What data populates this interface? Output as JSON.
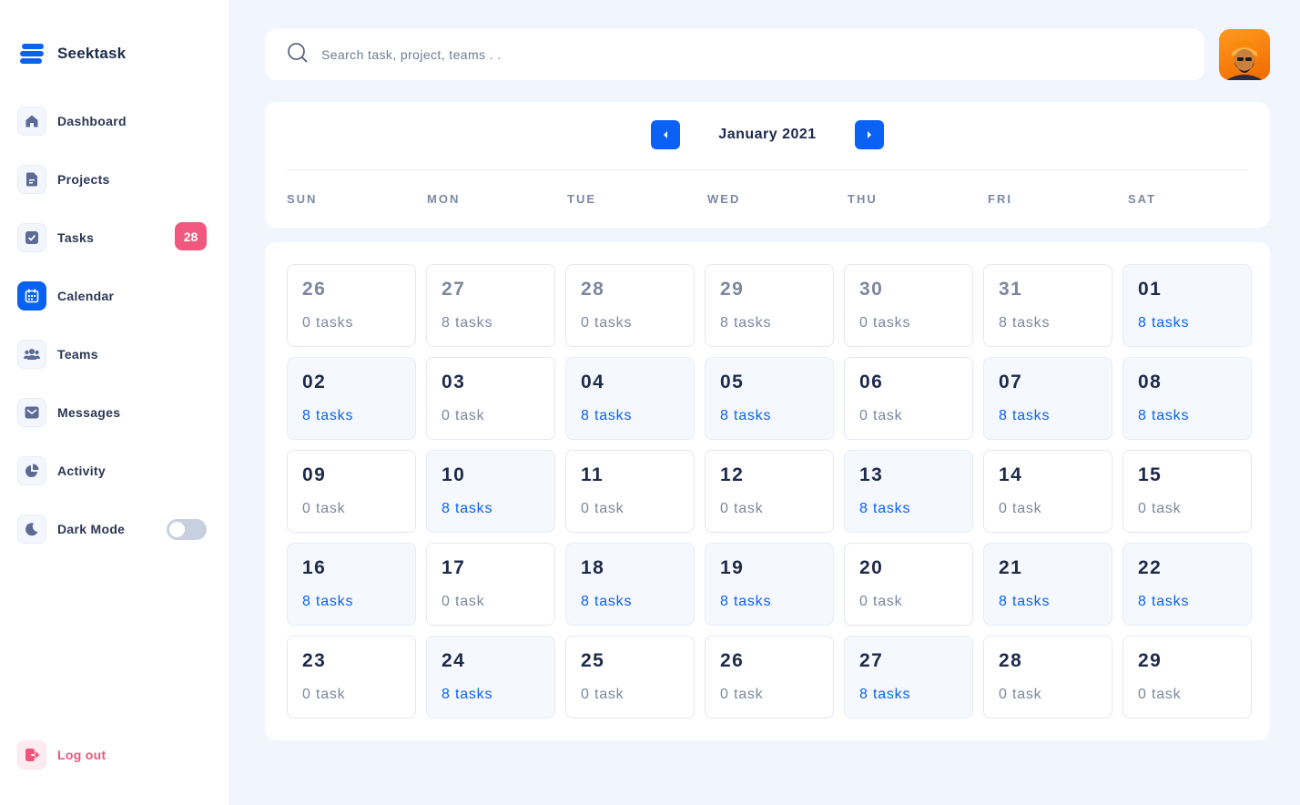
{
  "brand": {
    "name": "Seektask",
    "accent": "#0a62f4"
  },
  "sidebar": {
    "items": [
      {
        "label": "Dashboard",
        "icon": "home-icon"
      },
      {
        "label": "Projects",
        "icon": "document-icon"
      },
      {
        "label": "Tasks",
        "icon": "checkbox-icon",
        "badge": "28"
      },
      {
        "label": "Calendar",
        "icon": "calendar-icon",
        "active": true
      },
      {
        "label": "Teams",
        "icon": "users-icon"
      },
      {
        "label": "Messages",
        "icon": "mail-icon"
      },
      {
        "label": "Activity",
        "icon": "pie-chart-icon"
      },
      {
        "label": "Dark Mode",
        "icon": "moon-icon",
        "toggle": false
      }
    ],
    "logout": "Log out"
  },
  "search": {
    "placeholder": "Search task, project, teams . ."
  },
  "calendar": {
    "month": "January 2021",
    "weekdays": [
      "SUN",
      "MON",
      "TUE",
      "WED",
      "THU",
      "FRI",
      "SAT"
    ],
    "days": [
      {
        "num": "26",
        "count": "0 tasks",
        "muted": true
      },
      {
        "num": "27",
        "count": "8 tasks",
        "muted": true
      },
      {
        "num": "28",
        "count": "0 tasks",
        "muted": true
      },
      {
        "num": "29",
        "count": "8 tasks",
        "muted": true
      },
      {
        "num": "30",
        "count": "0 tasks",
        "muted": true
      },
      {
        "num": "31",
        "count": "8 tasks",
        "muted": true
      },
      {
        "num": "01",
        "count": "8 tasks",
        "busy": true
      },
      {
        "num": "02",
        "count": "8 tasks",
        "busy": true
      },
      {
        "num": "03",
        "count": "0 task"
      },
      {
        "num": "04",
        "count": "8 tasks",
        "busy": true
      },
      {
        "num": "05",
        "count": "8 tasks",
        "busy": true
      },
      {
        "num": "06",
        "count": "0 task"
      },
      {
        "num": "07",
        "count": "8 tasks",
        "busy": true
      },
      {
        "num": "08",
        "count": "8 tasks",
        "busy": true
      },
      {
        "num": "09",
        "count": "0 task"
      },
      {
        "num": "10",
        "count": "8 tasks",
        "busy": true
      },
      {
        "num": "11",
        "count": "0 task"
      },
      {
        "num": "12",
        "count": "0 task"
      },
      {
        "num": "13",
        "count": "8 tasks",
        "busy": true
      },
      {
        "num": "14",
        "count": "0 task"
      },
      {
        "num": "15",
        "count": "0 task"
      },
      {
        "num": "16",
        "count": "8 tasks",
        "busy": true
      },
      {
        "num": "17",
        "count": "0 task"
      },
      {
        "num": "18",
        "count": "8 tasks",
        "busy": true
      },
      {
        "num": "19",
        "count": "8 tasks",
        "busy": true
      },
      {
        "num": "20",
        "count": "0 task"
      },
      {
        "num": "21",
        "count": "8 tasks",
        "busy": true
      },
      {
        "num": "22",
        "count": "8 tasks",
        "busy": true
      },
      {
        "num": "23",
        "count": "0 task"
      },
      {
        "num": "24",
        "count": "8 tasks",
        "busy": true
      },
      {
        "num": "25",
        "count": "0 task"
      },
      {
        "num": "26",
        "count": "0 task"
      },
      {
        "num": "27",
        "count": "8 tasks",
        "busy": true
      },
      {
        "num": "28",
        "count": "0 task"
      },
      {
        "num": "29",
        "count": "0 task"
      }
    ]
  }
}
